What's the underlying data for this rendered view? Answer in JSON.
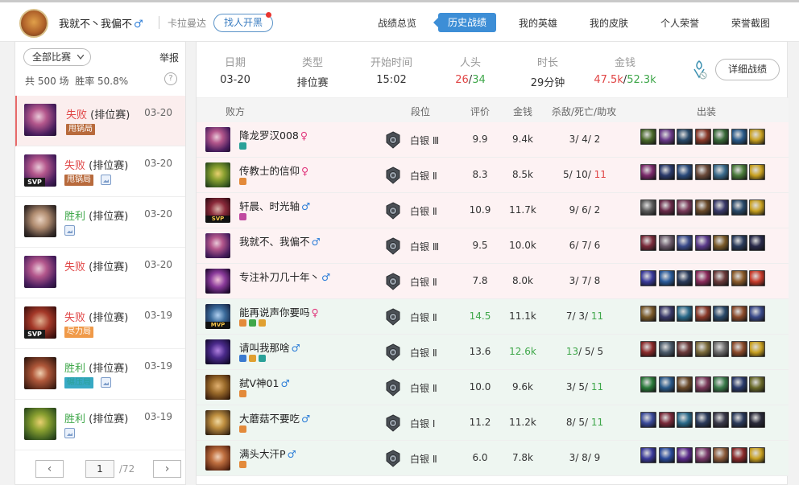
{
  "user": {
    "name": "我就不丶我偏不",
    "gender_symbol": "♂",
    "server": "卡拉曼达",
    "find_button": "找人开黑"
  },
  "nav": {
    "tabs": [
      "战绩总览",
      "历史战绩",
      "我的英雄",
      "我的皮肤",
      "个人荣誉",
      "荣誉截图"
    ],
    "active_index": 1
  },
  "sidebar": {
    "filter_label": "全部比赛",
    "report_label": "举报",
    "total_label": "共 500 场",
    "winrate_label": "胜率 50.8%",
    "help_symbol": "?",
    "matches": [
      {
        "result": "失败",
        "outcome": "loss",
        "type": "(排位赛)",
        "date": "03-20",
        "tag": "甩锅局",
        "tag_color": "brown",
        "svp": false,
        "photo": false,
        "selected": true,
        "champ": "purple"
      },
      {
        "result": "失败",
        "outcome": "loss",
        "type": "(排位赛)",
        "date": "03-20",
        "tag": "甩锅局",
        "tag_color": "brown",
        "svp": true,
        "photo": true,
        "selected": false,
        "champ": "purple"
      },
      {
        "result": "胜利",
        "outcome": "win",
        "type": "(排位赛)",
        "date": "03-20",
        "tag": "",
        "svp": false,
        "photo": true,
        "selected": false,
        "champ": "pale"
      },
      {
        "result": "失败",
        "outcome": "loss",
        "type": "(排位赛)",
        "date": "03-20",
        "tag": "",
        "svp": false,
        "photo": false,
        "selected": false,
        "champ": "purple"
      },
      {
        "result": "失败",
        "outcome": "loss",
        "type": "(排位赛)",
        "date": "03-19",
        "tag": "尽力局",
        "tag_color": "orange",
        "svp": true,
        "photo": false,
        "selected": false,
        "champ": "red"
      },
      {
        "result": "胜利",
        "outcome": "win",
        "type": "(排位赛)",
        "date": "03-19",
        "tag": "碾压局",
        "tag_color": "teal",
        "svp": false,
        "photo": true,
        "selected": false,
        "champ": "redhair"
      },
      {
        "result": "胜利",
        "outcome": "win",
        "type": "(排位赛)",
        "date": "03-19",
        "tag": "",
        "svp": false,
        "photo": true,
        "selected": false,
        "champ": "green"
      }
    ],
    "pager": {
      "prev": "‹",
      "next": "›",
      "current": "1",
      "total": "/72"
    }
  },
  "summary": {
    "headers": [
      "日期",
      "类型",
      "开始时间",
      "人头",
      "时长",
      "金钱"
    ],
    "date": "03-20",
    "type": "排位赛",
    "start_time": "15:02",
    "kills_red": "26",
    "kills_sep": "/",
    "kills_green": "34",
    "duration": "29分钟",
    "gold_red": "47.5k",
    "gold_sep": "/",
    "gold_green": "52.3k",
    "detail_button": "详细战绩"
  },
  "table": {
    "headers": [
      "败方",
      "段位",
      "评价",
      "金钱",
      "杀敌/死亡/助攻",
      "出装"
    ],
    "colors": {
      "loss_bg": "#fdf2f3",
      "win_bg": "#eef6f1",
      "red": "#e04646",
      "green": "#3fa74a"
    },
    "rows": [
      {
        "name": "降龙罗汉008",
        "gender": "♀",
        "side": "loss",
        "rank": "白银 Ⅲ",
        "score": "9.9",
        "score_hi": false,
        "gold": "9.4k",
        "gold_hi": false,
        "k": "3",
        "d": "4",
        "a": "2",
        "hi": "",
        "mvp": "",
        "champ": "purple",
        "badges": [
          "#2aa198"
        ],
        "items": [
          "#4a6a2a",
          "#6a3a8a",
          "#2a4a6a",
          "#8a3a2a",
          "#3a6a3a",
          "#2a5a8a",
          "#c8a020"
        ]
      },
      {
        "name": "传教士的信仰",
        "gender": "♀",
        "side": "loss",
        "rank": "白银 Ⅱ",
        "score": "8.3",
        "score_hi": false,
        "gold": "8.5k",
        "gold_hi": false,
        "k": "5",
        "d": "10",
        "a": "11",
        "hi": "a",
        "mvp": "",
        "champ": "green",
        "badges": [
          "#e38a3a"
        ],
        "items": [
          "#7a2a6a",
          "#2a3a6a",
          "#2a4a7a",
          "#6a4a3a",
          "#3a6a8a",
          "#4a7a3a",
          "#c8a020"
        ]
      },
      {
        "name": "轩晨、时光轴",
        "gender": "♂",
        "side": "loss",
        "rank": "白银 Ⅱ",
        "score": "10.9",
        "score_hi": false,
        "gold": "11.7k",
        "gold_hi": false,
        "k": "9",
        "d": "6",
        "a": "2",
        "hi": "",
        "mvp": "svp",
        "champ": "darkred",
        "badges": [
          "#c04aa0"
        ],
        "items": [
          "#5a5a5a",
          "#6a2a4a",
          "#7a3a5a",
          "#6a4a2a",
          "#3a3a6a",
          "#2a4a6a",
          "#c8a020"
        ]
      },
      {
        "name": "我就不、我偏不",
        "gender": "♂",
        "side": "loss",
        "rank": "白银 Ⅲ",
        "score": "9.5",
        "score_hi": false,
        "gold": "10.0k",
        "gold_hi": false,
        "k": "6",
        "d": "7",
        "a": "6",
        "hi": "",
        "mvp": "",
        "champ": "purple",
        "badges": [],
        "items": [
          "#7a2a3a",
          "#6a5a6a",
          "#3a4a8a",
          "#5a3a8a",
          "#7a5a2a",
          "#2a3a5a",
          "#2a2a4a"
        ]
      },
      {
        "name": "专注补刀几十年丶",
        "gender": "♂",
        "side": "loss",
        "rank": "白银 Ⅱ",
        "score": "7.8",
        "score_hi": false,
        "gold": "8.0k",
        "gold_hi": false,
        "k": "3",
        "d": "7",
        "a": "8",
        "hi": "",
        "mvp": "",
        "champ": "violet",
        "badges": [],
        "items": [
          "#3a3a9a",
          "#2a5a9a",
          "#2a3a5a",
          "#8a2a5a",
          "#6a3a3a",
          "#8a5a2a",
          "#c83a2a"
        ]
      },
      {
        "name": "能再说声你要吗",
        "gender": "♀",
        "side": "win",
        "rank": "白银 Ⅱ",
        "score": "14.5",
        "score_hi": true,
        "gold": "11.1k",
        "gold_hi": false,
        "k": "7",
        "d": "3",
        "a": "11",
        "hi": "a",
        "mvp": "mvp",
        "champ": "tech",
        "badges": [
          "#e38a3a",
          "#3fa74a",
          "#e0a030"
        ],
        "items": [
          "#7a5a2a",
          "#3a3a6a",
          "#2a6a8a",
          "#8a3a2a",
          "#2a4a6a",
          "#8a4a2a",
          "#3a4a8a"
        ]
      },
      {
        "name": "请叫我那啥",
        "gender": "♂",
        "side": "win",
        "rank": "白银 Ⅱ",
        "score": "13.6",
        "score_hi": false,
        "gold": "12.6k",
        "gold_hi": true,
        "k": "13",
        "d": "5",
        "a": "5",
        "hi": "k",
        "mvp": "",
        "champ": "dark",
        "badges": [
          "#3a7ad0",
          "#e0a030",
          "#2aa198"
        ],
        "items": [
          "#8a2a2a",
          "#4a5a6a",
          "#6a3a3a",
          "#7a6a3a",
          "#6a6a6a",
          "#8a4a2a",
          "#c8a020"
        ]
      },
      {
        "name": "弑V神01",
        "gender": "♂",
        "side": "win",
        "rank": "白银 Ⅱ",
        "score": "10.0",
        "score_hi": false,
        "gold": "9.6k",
        "gold_hi": false,
        "k": "3",
        "d": "5",
        "a": "11",
        "hi": "a",
        "mvp": "",
        "champ": "brown",
        "badges": [
          "#e38a3a"
        ],
        "items": [
          "#2a7a3a",
          "#2a5a8a",
          "#6a4a2a",
          "#7a3a5a",
          "#3a7a4a",
          "#2a3a6a",
          "#6a6a2a"
        ]
      },
      {
        "name": "大蘑菇不要吃",
        "gender": "♂",
        "side": "win",
        "rank": "白银 Ⅰ",
        "score": "11.2",
        "score_hi": false,
        "gold": "11.2k",
        "gold_hi": false,
        "k": "8",
        "d": "5",
        "a": "11",
        "hi": "a",
        "mvp": "",
        "champ": "blond",
        "badges": [
          "#e38a3a"
        ],
        "items": [
          "#3a4a9a",
          "#7a2a3a",
          "#2a6a8a",
          "#2a3a5a",
          "#3a3a4a",
          "#2a3a5a",
          "#2a2a3a"
        ]
      },
      {
        "name": "满头大汗P",
        "gender": "♂",
        "side": "win",
        "rank": "白银 Ⅱ",
        "score": "6.0",
        "score_hi": false,
        "gold": "7.8k",
        "gold_hi": false,
        "k": "3",
        "d": "8",
        "a": "9",
        "hi": "",
        "mvp": "",
        "champ": "auburn",
        "badges": [
          "#e38a3a"
        ],
        "items": [
          "#3a3a9a",
          "#2a4a9a",
          "#5a2a8a",
          "#7a3a6a",
          "#8a5a3a",
          "#8a2a2a",
          "#c8a020"
        ]
      }
    ]
  }
}
